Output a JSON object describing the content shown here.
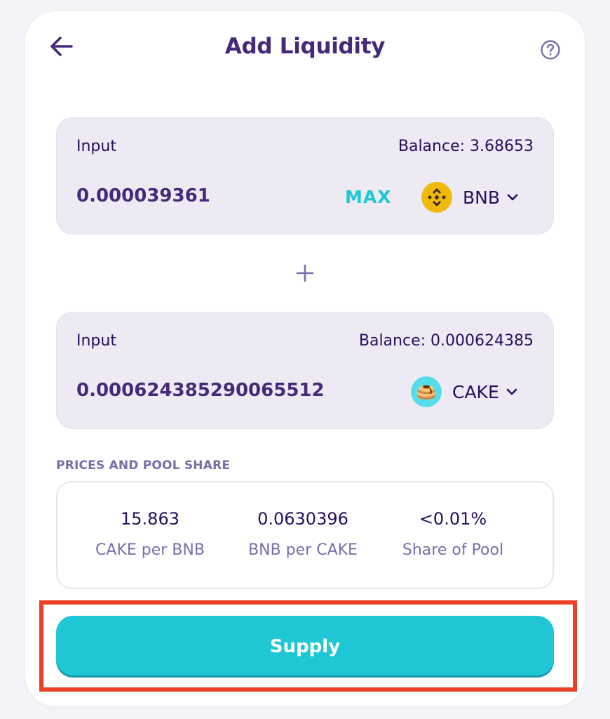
{
  "header": {
    "title": "Add Liquidity",
    "back_icon": "arrow-left-icon",
    "help_icon": "question-circle-icon"
  },
  "token_a": {
    "label": "Input",
    "balance": "Balance: 3.68653",
    "amount": "0.000039361",
    "max_label": "MAX",
    "symbol": "BNB",
    "logo_icon": "bnb-logo-icon"
  },
  "token_b": {
    "label": "Input",
    "balance": "Balance: 0.000624385",
    "amount": "0.000624385290065512",
    "symbol": "CAKE",
    "logo_icon": "cake-logo-icon"
  },
  "separator_icon": "plus-icon",
  "prices": {
    "title": "PRICES AND POOL SHARE",
    "items": [
      {
        "value": "15.863",
        "label": "CAKE per BNB"
      },
      {
        "value": "0.0630396",
        "label": "BNB per CAKE"
      },
      {
        "value": "<0.01%",
        "label": "Share of Pool"
      }
    ]
  },
  "supply_label": "Supply",
  "colors": {
    "primary": "#1fc7d4",
    "text_dark": "#280d5f",
    "text_muted": "#7a6eaa",
    "panel_bg": "#eeeaf4",
    "highlight": "#e84126",
    "bnb": "#f0b90b"
  }
}
